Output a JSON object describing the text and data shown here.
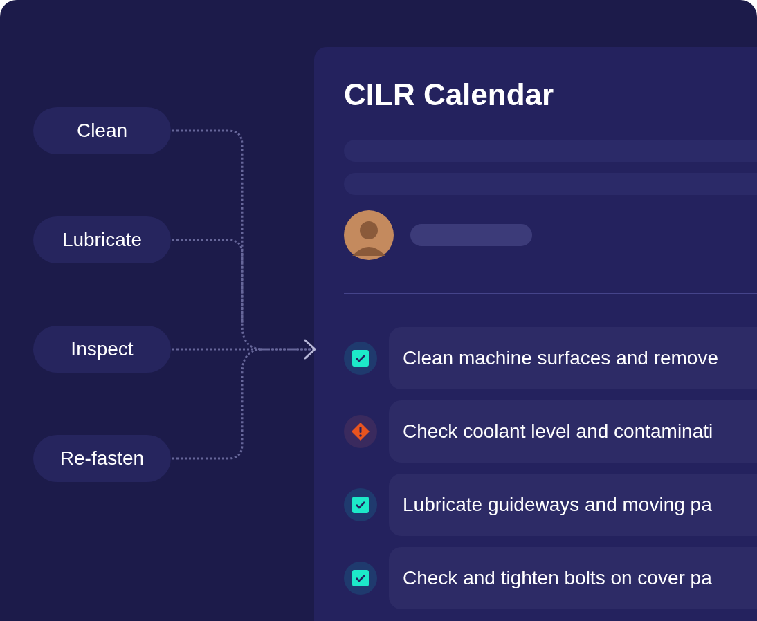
{
  "categories": [
    "Clean",
    "Lubricate",
    "Inspect",
    "Re-fasten"
  ],
  "calendar": {
    "title": "CILR Calendar",
    "tasks": [
      {
        "kind": "done",
        "text": "Clean machine surfaces and remove"
      },
      {
        "kind": "alert",
        "text": "Check coolant level and contaminati"
      },
      {
        "kind": "done",
        "text": "Lubricate guideways and moving pa"
      },
      {
        "kind": "done",
        "text": "Check and tighten bolts on cover pa"
      }
    ]
  }
}
